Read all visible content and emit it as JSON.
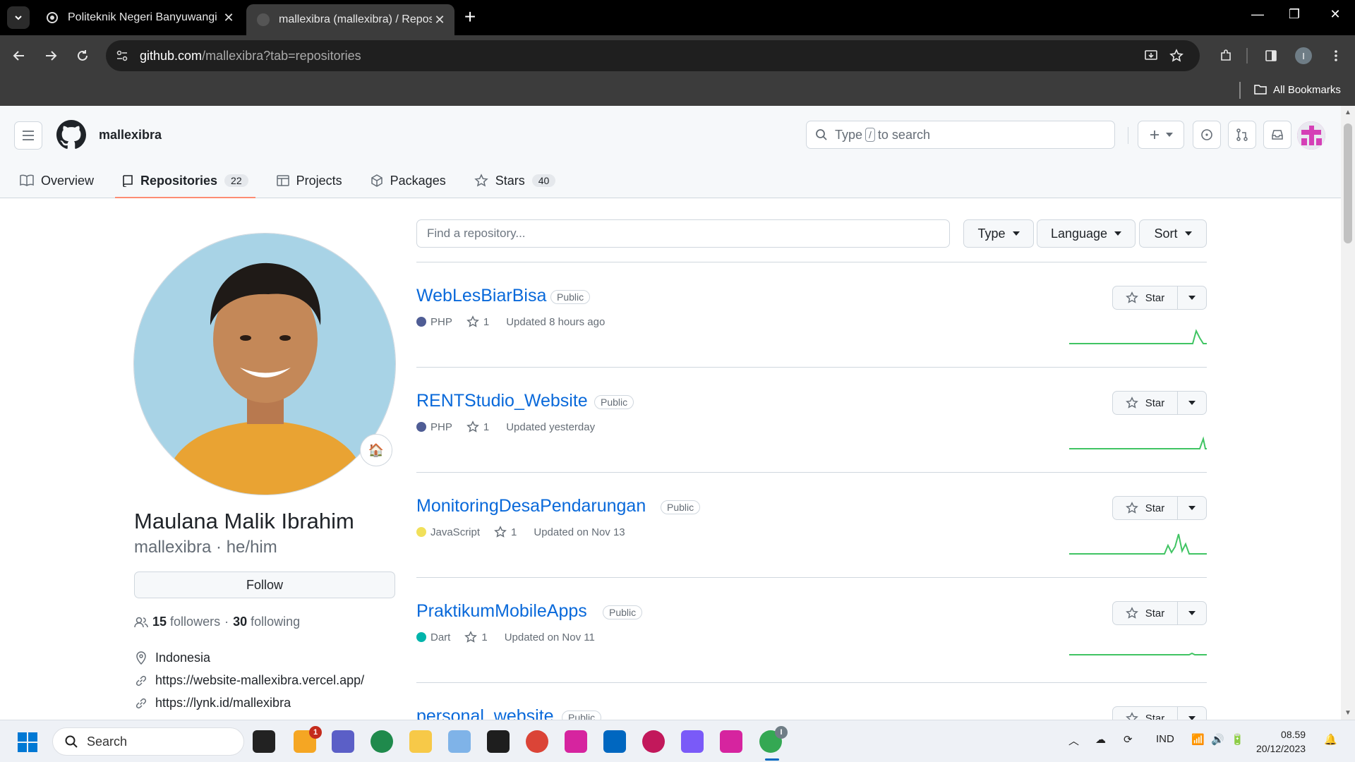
{
  "browser": {
    "tabs": [
      {
        "title": "Politeknik Negeri Banyuwangi",
        "active": false
      },
      {
        "title": "mallexibra (mallexibra) / Reposi",
        "active": true
      }
    ],
    "url_host": "github.com",
    "url_rest": "/mallexibra?tab=repositories",
    "profile_initial": "I",
    "bookmarks_label": "All Bookmarks"
  },
  "header": {
    "username": "mallexibra",
    "search_prefix": "Type",
    "search_key": "/",
    "search_suffix": "to search"
  },
  "nav": {
    "overview": "Overview",
    "repositories": "Repositories",
    "repositories_count": "22",
    "projects": "Projects",
    "packages": "Packages",
    "stars": "Stars",
    "stars_count": "40"
  },
  "profile": {
    "full_name": "Maulana Malik Ibrahim",
    "login_line": "mallexibra · he/him",
    "follow_label": "Follow",
    "followers_count": "15",
    "followers_label": "followers",
    "separator": "·",
    "following_count": "30",
    "following_label": "following",
    "location": "Indonesia",
    "website": "https://website-mallexibra.vercel.app/",
    "link2": "https://lynk.id/mallexibra",
    "status_emoji": "🏠"
  },
  "repo_controls": {
    "search_placeholder": "Find a repository...",
    "type_label": "Type",
    "language_label": "Language",
    "sort_label": "Sort"
  },
  "repos": [
    {
      "name": "WebLesBiarBisa",
      "visibility": "Public",
      "language": "PHP",
      "lang_color": "#4F5D95",
      "stars": "1",
      "updated": "Updated 8 hours ago",
      "star_label": "Star"
    },
    {
      "name": "RENTStudio_Website",
      "visibility": "Public",
      "language": "PHP",
      "lang_color": "#4F5D95",
      "stars": "1",
      "updated": "Updated yesterday",
      "star_label": "Star"
    },
    {
      "name": "MonitoringDesaPendarungan",
      "visibility": "Public",
      "language": "JavaScript",
      "lang_color": "#f1e05a",
      "stars": "1",
      "updated": "Updated on Nov 13",
      "star_label": "Star"
    },
    {
      "name": "PraktikumMobileApps",
      "visibility": "Public",
      "language": "Dart",
      "lang_color": "#00B4AB",
      "stars": "1",
      "updated": "Updated on Nov 11",
      "star_label": "Star"
    },
    {
      "name": "personal_website",
      "visibility": "Public",
      "language": "",
      "lang_color": "#cccccc",
      "stars": "",
      "updated": "",
      "star_label": "Star"
    }
  ],
  "taskbar": {
    "search_label": "Search",
    "mail_badge": "1",
    "chrome_badge": "I",
    "tray_lang": "IND",
    "time": "08.59",
    "date": "20/12/2023"
  }
}
